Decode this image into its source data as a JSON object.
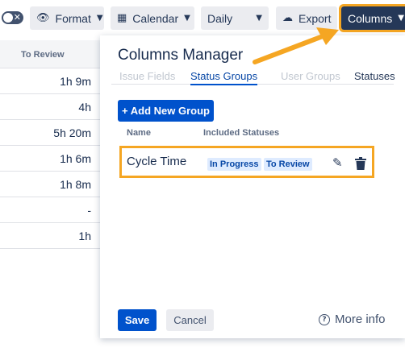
{
  "toolbar": {
    "format_label": "Format",
    "calendar_label": "Calendar",
    "daily_label": "Daily",
    "export_label": "Export",
    "columns_label": "Columns"
  },
  "table": {
    "header": "To Review",
    "rows": [
      "1h 9m",
      "4h",
      "5h 20m",
      "1h 6m",
      "1h 8m",
      "-",
      "1h"
    ]
  },
  "modal": {
    "title": "Columns Manager",
    "tabs": [
      "Issue Fields",
      "Status Groups",
      "User Groups",
      "Statuses"
    ],
    "active_tab": "Status Groups",
    "add_button": "+ Add New Group",
    "columns": {
      "name": "Name",
      "statuses": "Included Statuses"
    },
    "groups": [
      {
        "name": "Cycle Time",
        "statuses": [
          "In Progress",
          "To Review"
        ]
      }
    ],
    "save": "Save",
    "cancel": "Cancel",
    "more_info": "More info"
  },
  "colors": {
    "accent": "#0052cc",
    "highlight": "#f5a623",
    "columns_button": "#253858",
    "lozenge_bg": "#deebff"
  },
  "icons": [
    "eye-icon",
    "calendar-icon",
    "cloud-download-icon",
    "chevron-down-icon",
    "pencil-icon",
    "trash-icon",
    "question-circle-icon"
  ]
}
